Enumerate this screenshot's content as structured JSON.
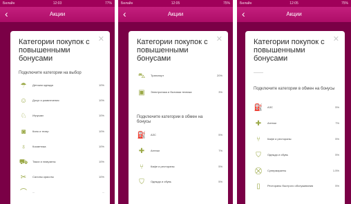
{
  "colors": {
    "brand": "#a0005a",
    "header": "#c41f7d",
    "icon": "#9aa845"
  },
  "screens": [
    {
      "status": {
        "carrier": "Билайн",
        "time": "12:03",
        "right": "77%"
      },
      "nav": {
        "back_icon": "chevron-left-icon",
        "title": "Акции"
      },
      "card": {
        "title": "Категории покупок с повышенными бонусами",
        "close_icon": "close-icon",
        "section_choose": "Подключите категории на выбор",
        "choose": [
          {
            "label": "Детская одежда",
            "pct": "10%",
            "icon": "kids-clothes-icon"
          },
          {
            "label": "Досуг и развлечения",
            "pct": "10%",
            "icon": "leisure-icon"
          },
          {
            "label": "Игрушки",
            "pct": "10%",
            "icon": "toys-icon"
          },
          {
            "label": "Кино и театр",
            "pct": "10%",
            "icon": "cinema-icon"
          },
          {
            "label": "Косметика",
            "pct": "10%",
            "icon": "cosmetics-icon"
          },
          {
            "label": "Такси и лимузины",
            "pct": "10%",
            "icon": "taxi-icon"
          },
          {
            "label": "Салоны красоты",
            "pct": "10%",
            "icon": "beauty-salon-icon"
          },
          {
            "label": "...",
            "pct": "...",
            "icon": "more-icon"
          }
        ]
      }
    },
    {
      "status": {
        "carrier": "Билайн",
        "time": "12:05",
        "right": "75%"
      },
      "nav": {
        "back_icon": "chevron-left-icon",
        "title": "Акции"
      },
      "card": {
        "title": "Категории покупок с повышенными бонусами",
        "close_icon": "close-icon",
        "choose": [
          {
            "label": "Транспорт",
            "pct": "20%",
            "icon": "transport-icon"
          },
          {
            "label": "Электроника и бытовая техника",
            "pct": "3%",
            "icon": "electronics-icon"
          }
        ],
        "section_exchange": "Подключите категории в обмен на бонусы",
        "exchange": [
          {
            "label": "АЗС",
            "pct": "5%",
            "icon": "gas-station-icon"
          },
          {
            "label": "Аптеки",
            "pct": "7%",
            "icon": "pharmacy-icon"
          },
          {
            "label": "Кафе и рестораны",
            "pct": "5%",
            "icon": "restaurant-icon"
          },
          {
            "label": "Одежда и обувь",
            "pct": "5%",
            "icon": "clothes-icon"
          }
        ]
      }
    },
    {
      "status": {
        "carrier": "Билайн",
        "time": "12:05",
        "right": "75%"
      },
      "nav": {
        "back_icon": "chevron-left-icon",
        "title": "Акции"
      },
      "card": {
        "title": "Категории покупок с повышенными бонусами",
        "close_icon": "close-icon",
        "section_exchange": "Подключите категории в обмен на бонусы",
        "exchange": [
          {
            "label": "АЗС",
            "pct": "5%",
            "icon": "gas-station-icon"
          },
          {
            "label": "Аптеки",
            "pct": "7%",
            "icon": "pharmacy-icon"
          },
          {
            "label": "Кафе и рестораны",
            "pct": "5%",
            "icon": "restaurant-icon"
          },
          {
            "label": "Одежда и обувь",
            "pct": "5%",
            "icon": "clothes-icon"
          },
          {
            "label": "Супермаркеты",
            "pct": "1.5%",
            "icon": "supermarket-icon"
          },
          {
            "label": "Рестораны быстрого обслуживания",
            "pct": "5%",
            "icon": "fast-food-icon"
          }
        ]
      }
    }
  ]
}
